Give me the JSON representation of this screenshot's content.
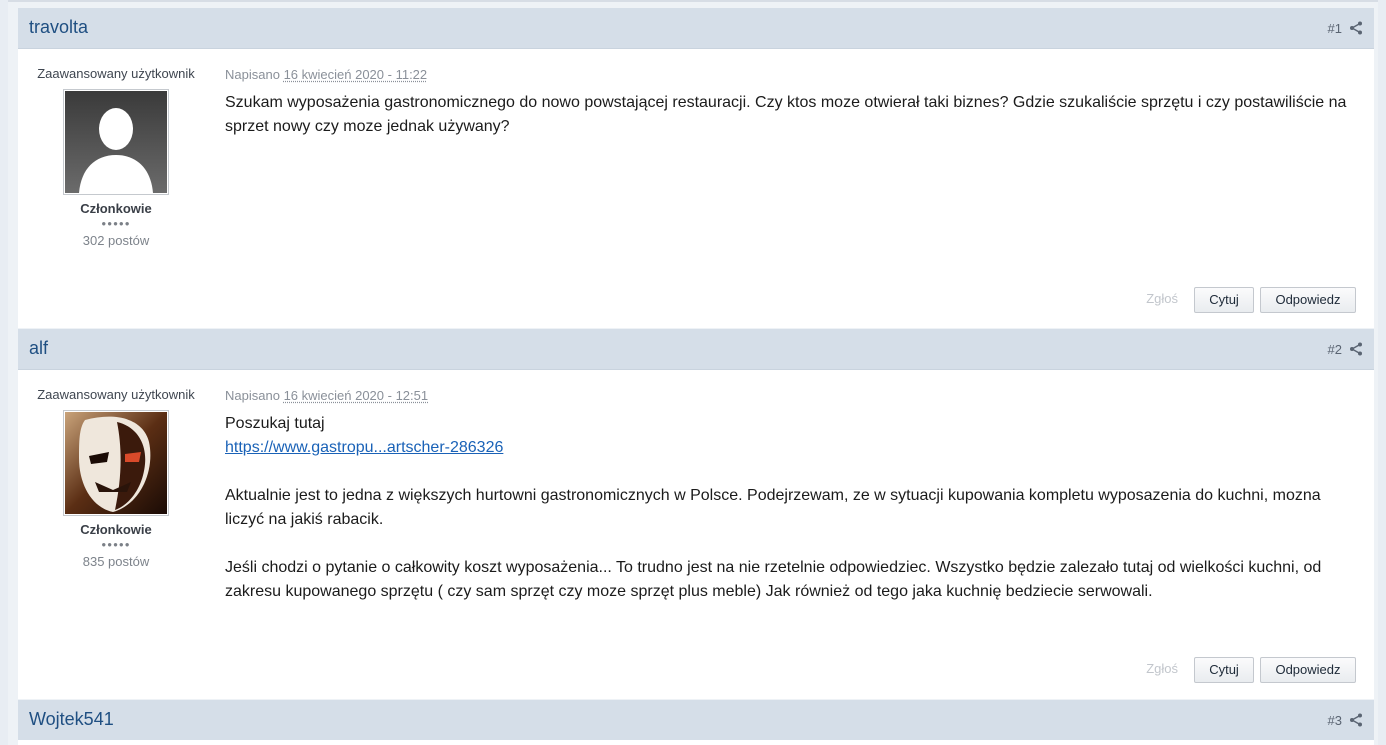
{
  "posts": [
    {
      "author": "travolta",
      "number": "#1",
      "rank_title": "Zaawansowany użytkownik",
      "group": "Członkowie",
      "pips": "●●●●●",
      "post_count": "302 postów",
      "posted_label": "Napisano",
      "posted_date": "16 kwiecień 2020 - 11:22",
      "paragraphs": [
        "Szukam wyposażenia gastronomicznego do nowo powstającej restauracji. Czy ktos moze otwierał taki biznes? Gdzie szukaliście sprzętu i czy postawiliście na sprzet nowy czy moze jednak używany?"
      ],
      "report_label": "Zgłoś",
      "quote_label": "Cytuj",
      "reply_label": "Odpowiedz"
    },
    {
      "author": "alf",
      "number": "#2",
      "rank_title": "Zaawansowany użytkownik",
      "group": "Członkowie",
      "pips": "●●●●●",
      "post_count": "835 postów",
      "posted_label": "Napisano",
      "posted_date": "16 kwiecień 2020 - 12:51",
      "line1": "Poszukaj tutaj",
      "link": "https://www.gastropu...artscher-286326",
      "paragraph2": "Aktualnie jest to jedna z większych hurtowni gastronomicznych w Polsce. Podejrzewam, ze w sytuacji kupowania kompletu wyposazenia do kuchni, mozna liczyć na jakiś rabacik.",
      "paragraph3": "Jeśli chodzi o pytanie o całkowity koszt wyposażenia... To trudno jest na nie rzetelnie odpowiedziec. Wszystko będzie zalezało tutaj od wielkości kuchni, od zakresu kupowanego sprzętu ( czy sam sprzęt czy moze sprzęt plus meble) Jak również od tego jaka kuchnię bedziecie serwowali.",
      "report_label": "Zgłoś",
      "quote_label": "Cytuj",
      "reply_label": "Odpowiedz"
    },
    {
      "author": "Wojtek541",
      "number": "#3"
    }
  ],
  "icons": {
    "share": "share-icon",
    "avatar_default": "default-avatar-silhouette"
  },
  "colors": {
    "header_bg": "#d5dee8",
    "author_link": "#1f4f82",
    "link": "#1a62b7"
  }
}
